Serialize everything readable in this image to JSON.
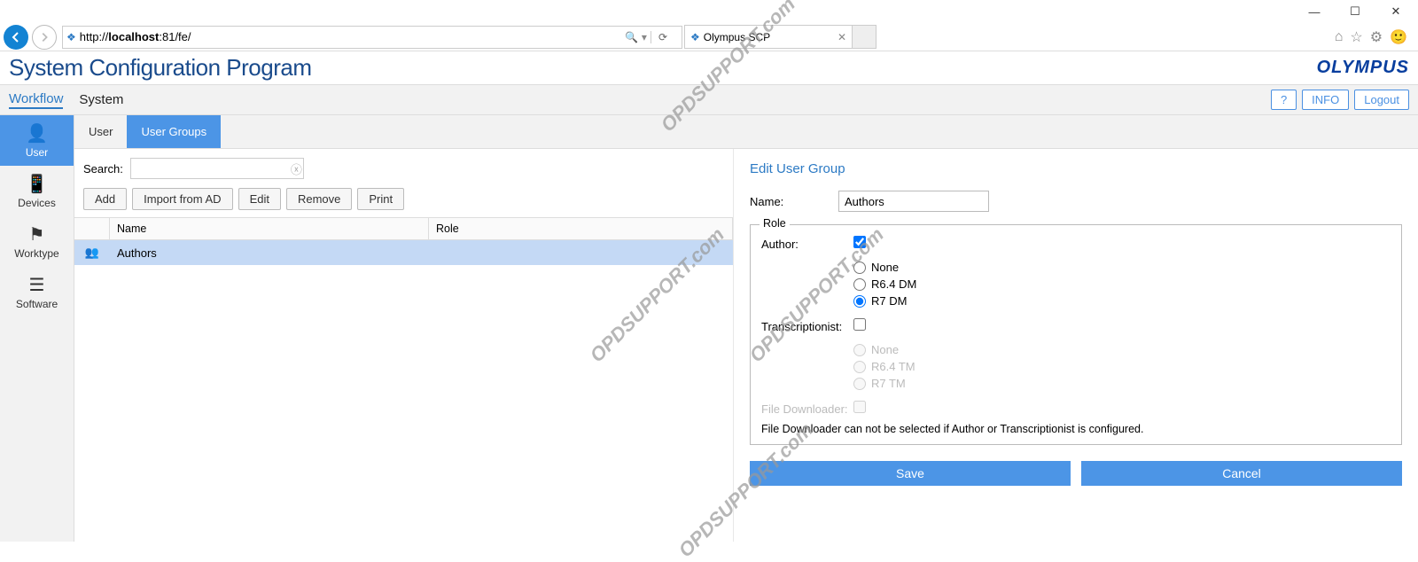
{
  "browser": {
    "url_prefix": "http://",
    "url_host": "localhost",
    "url_suffix": ":81/fe/",
    "tab_title": "Olympus SCP"
  },
  "app": {
    "title": "System Configuration Program",
    "brand": "OLYMPUS"
  },
  "topnav": {
    "workflow": "Workflow",
    "system": "System",
    "help": "?",
    "info": "INFO",
    "logout": "Logout"
  },
  "sidebar": {
    "user": "User",
    "devices": "Devices",
    "worktype": "Worktype",
    "software": "Software"
  },
  "subtabs": {
    "user": "User",
    "user_groups": "User Groups"
  },
  "list": {
    "search_label": "Search:",
    "search_value": "",
    "buttons": {
      "add": "Add",
      "import": "Import from AD",
      "edit": "Edit",
      "remove": "Remove",
      "print": "Print"
    },
    "columns": {
      "name": "Name",
      "role": "Role"
    },
    "rows": [
      {
        "name": "Authors",
        "role": ""
      }
    ]
  },
  "edit": {
    "title": "Edit User Group",
    "name_label": "Name:",
    "name_value": "Authors",
    "role_legend": "Role",
    "author_label": "Author:",
    "author_checked": true,
    "author_opts": {
      "none": "None",
      "r64": "R6.4 DM",
      "r7": "R7 DM",
      "selected": "r7"
    },
    "trans_label": "Transcriptionist:",
    "trans_checked": false,
    "trans_opts": {
      "none": "None",
      "r64": "R6.4 TM",
      "r7": "R7 TM"
    },
    "fd_label": "File Downloader:",
    "fd_checked": false,
    "fd_warn": "File Downloader can not be selected if Author or Transcriptionist is configured.",
    "save": "Save",
    "cancel": "Cancel"
  },
  "watermark": "OPDSUPPORT.com"
}
